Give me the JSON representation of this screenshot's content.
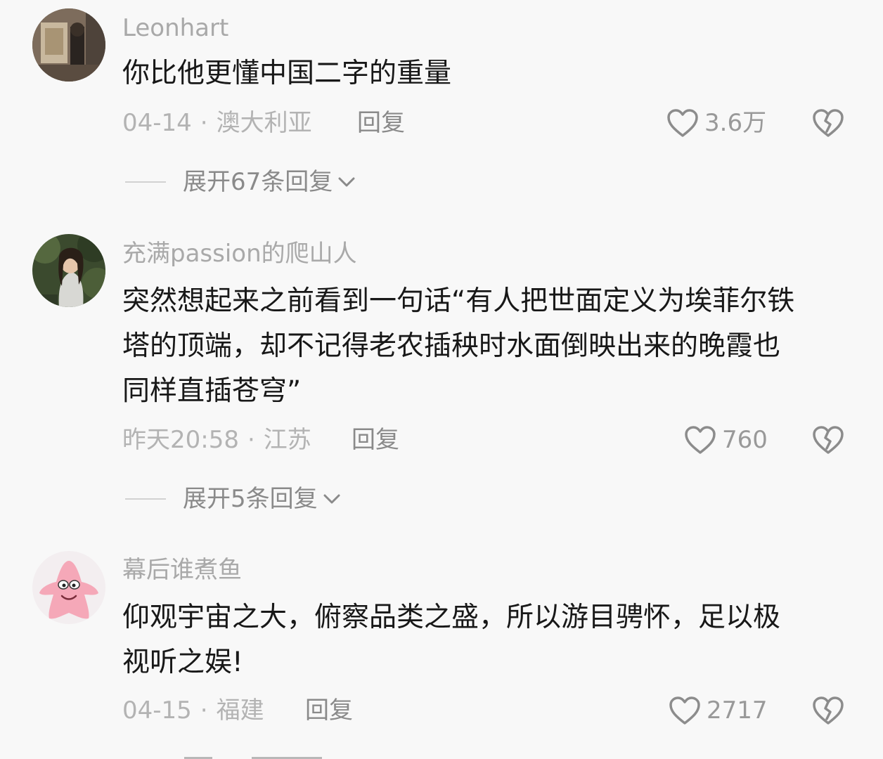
{
  "comments": [
    {
      "username": "Leonhart",
      "text_lines": [
        "你比他更懂中国二字的重量"
      ],
      "date": "04-14",
      "location": "澳大利亚",
      "reply_label": "回复",
      "likes": "3.6万",
      "expand_label": "展开67条回复"
    },
    {
      "username": "充满passion的爬山人",
      "text_lines": [
        "突然想起来之前看到一句话“有人把世面定义为埃菲尔铁",
        "塔的顶端，却不记得老农插秧时水面倒映出来的晚霞也",
        "同样直插苍穹”"
      ],
      "date": "昨天20:58",
      "location": "江苏",
      "reply_label": "回复",
      "likes": "760",
      "expand_label": "展开5条回复"
    },
    {
      "username": "幕后谁煮鱼",
      "text_lines": [
        "仰观宇宙之大，俯察品类之盛，所以游目骋怀，足以极",
        "视听之娱!"
      ],
      "date": "04-15",
      "location": "福建",
      "reply_label": "回复",
      "likes": "2717"
    }
  ],
  "separator": "·",
  "icons": {
    "like": "heart-outline-icon",
    "dislike": "broken-heart-icon",
    "expand": "chevron-down-icon"
  },
  "colors": {
    "background": "#f8f8f8",
    "text": "#181818",
    "muted": "#a9a9a9",
    "action": "#8a8a8a"
  }
}
